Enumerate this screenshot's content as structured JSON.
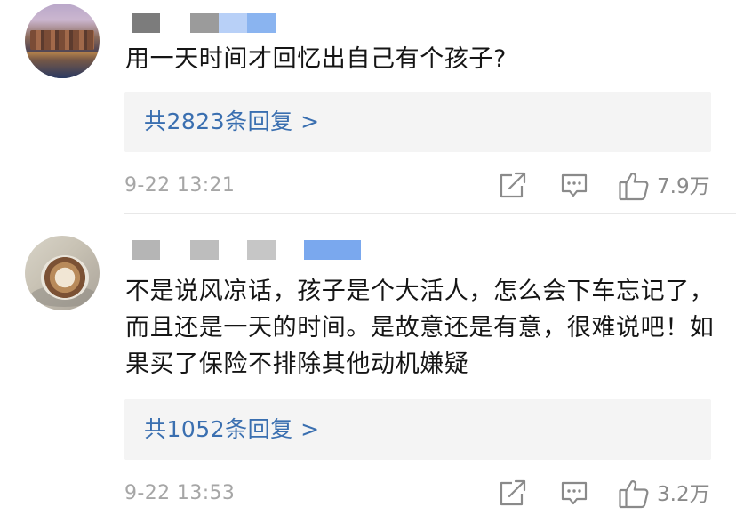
{
  "comments": [
    {
      "text": "用一天时间才回忆出自己有个孩子?",
      "replies_label": "共2823条回复 >",
      "timestamp": "9-22 13:21",
      "like_count": "7.9万",
      "avatar_icon": "city-waterfront-photo-icon",
      "name_redaction_colors": [
        "#7c7c7c",
        "#9b9b9b",
        "#b8d0f7",
        "#8ab4f0"
      ]
    },
    {
      "text": "不是说风凉话，孩子是个大活人，怎么会下车忘记了，而且还是一天的时间。是故意还是有意，很难说吧！如果买了保险不排除其他动机嫌疑",
      "replies_label": "共1052条回复 >",
      "timestamp": "9-22 13:53",
      "like_count": "3.2万",
      "avatar_icon": "coffee-cup-photo-icon",
      "name_redaction_colors": [
        "#b5b5b5",
        "#bdbdbd",
        "#c6c6c6",
        "#7aa8ee"
      ]
    }
  ],
  "icons": {
    "share": "share-icon",
    "comment": "comment-icon",
    "like": "thumbs-up-icon"
  },
  "colors": {
    "reply_link": "#3a6fb0",
    "muted_text": "#a6a6a6",
    "panel_bg": "#f4f4f4"
  }
}
